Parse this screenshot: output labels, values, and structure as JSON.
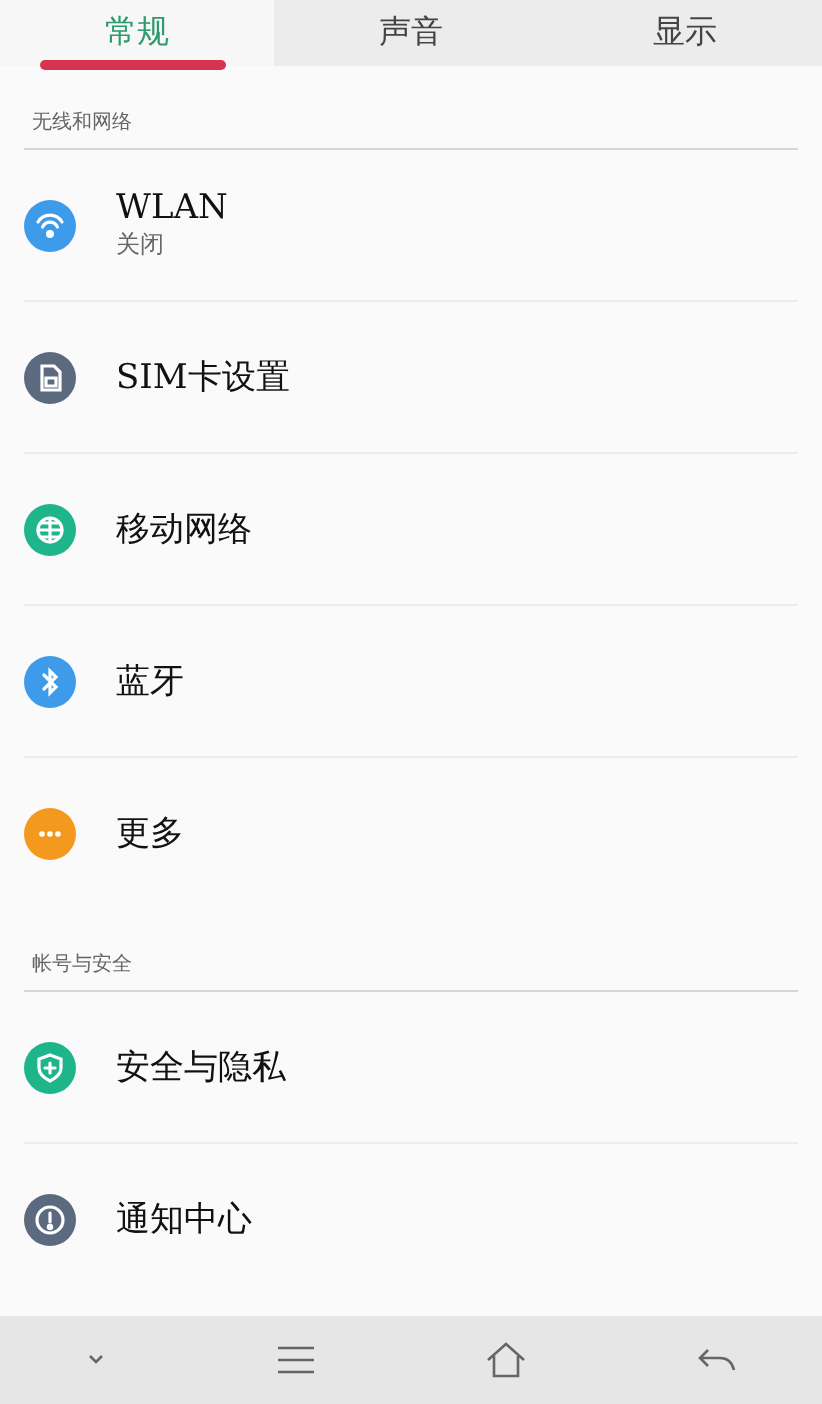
{
  "tabs": [
    {
      "label": "常规",
      "selected": true
    },
    {
      "label": "声音",
      "selected": false
    },
    {
      "label": "显示",
      "selected": false
    }
  ],
  "sections": [
    {
      "title": "无线和网络",
      "items": [
        {
          "label": "WLAN",
          "subtitle": "关闭",
          "kind": "wifi",
          "color": "#3d9be9"
        },
        {
          "label": "SIM卡设置",
          "kind": "sim",
          "color": "#5b6a7e"
        },
        {
          "label": "移动网络",
          "kind": "globe",
          "color": "#1fb58a"
        },
        {
          "label": "蓝牙",
          "kind": "bluetooth",
          "color": "#3d9be9"
        },
        {
          "label": "更多",
          "kind": "more",
          "color": "#f39a1e"
        }
      ]
    },
    {
      "title": "帐号与安全",
      "items": [
        {
          "label": "安全与隐私",
          "kind": "shield",
          "color": "#1fb58a"
        },
        {
          "label": "通知中心",
          "kind": "alert",
          "color": "#5b6a7e"
        }
      ]
    }
  ]
}
